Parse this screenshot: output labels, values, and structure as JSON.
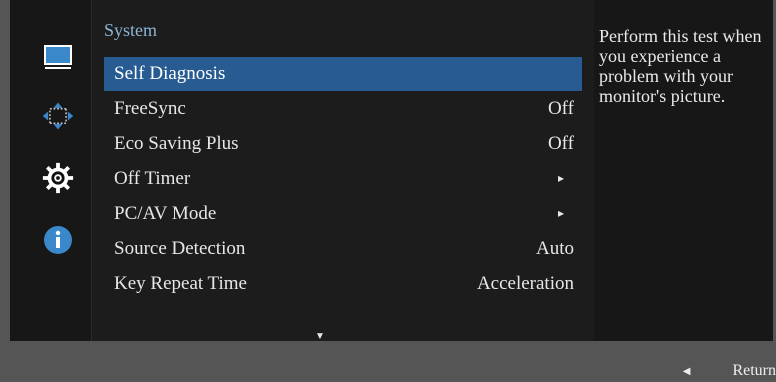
{
  "menu": {
    "title": "System",
    "items": [
      {
        "label": "Self Diagnosis",
        "value": ""
      },
      {
        "label": "FreeSync",
        "value": "Off"
      },
      {
        "label": "Eco Saving Plus",
        "value": "Off"
      },
      {
        "label": "Off Timer",
        "value": "▸"
      },
      {
        "label": "PC/AV Mode",
        "value": "▸"
      },
      {
        "label": "Source Detection",
        "value": "Auto"
      },
      {
        "label": "Key Repeat Time",
        "value": "Acceleration"
      }
    ]
  },
  "info": {
    "text": "Perform this test when you experience a problem with your monitor's picture."
  },
  "footer": {
    "return_label": "Return",
    "return_icon": "left-triangle"
  },
  "icons": {
    "rail": [
      "monitor-icon",
      "size-position-icon",
      "gear-icon",
      "info-icon"
    ]
  },
  "colors": {
    "accent": "#275b91",
    "title": "#8cb6d6"
  }
}
